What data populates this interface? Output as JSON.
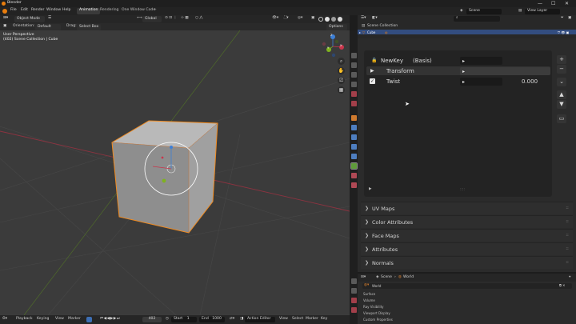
{
  "window": {
    "title": "Blender",
    "controls": [
      "—",
      "☐",
      "✕"
    ]
  },
  "menu": {
    "items": [
      "File",
      "Edit",
      "Render",
      "Window",
      "Help"
    ]
  },
  "workspace_tabs": [
    {
      "label": "Animation",
      "active": true
    },
    {
      "label": "Rendering",
      "active": false
    },
    {
      "label": "One Window Code",
      "active": false
    },
    {
      "label": "+",
      "active": false
    }
  ],
  "scene": {
    "label": "Scene",
    "view_layer": "View Layer"
  },
  "viewport_header": {
    "mode": "Object Mode",
    "transform": "Global"
  },
  "tool_settings": {
    "orientation_label": "Orientation:",
    "orientation_value": "Default",
    "drag_label": "Drag:",
    "drag_value": "Select Box",
    "options": "Options"
  },
  "viewport_info": {
    "line1": "User Perspective",
    "line2": "(402) Scene Collection | Cube"
  },
  "gizmo": {
    "x": "X",
    "y": "Y",
    "z": "Z"
  },
  "outliner": {
    "collection": "Scene Collection",
    "object": "Cube"
  },
  "shape_keys": [
    {
      "name": "NewKey",
      "suffix": "(Basis)",
      "value": "",
      "highlight": false
    },
    {
      "name": "Transform",
      "suffix": "",
      "value": "",
      "highlight": true
    },
    {
      "name": "Twist",
      "suffix": "",
      "value": "0.000",
      "highlight": false
    }
  ],
  "sections": [
    "UV Maps",
    "Color Attributes",
    "Face Maps",
    "Attributes",
    "Normals"
  ],
  "shader_header": {
    "scene": "Scene",
    "world": "World",
    "world_name": "World"
  },
  "shader_items": [
    "Surface",
    "Volume",
    "Ray Visibility",
    "Viewport Display",
    "Custom Properties"
  ],
  "timeline": {
    "menus": [
      "Playback",
      "Keying",
      "View",
      "Marker"
    ],
    "current_frame": "402",
    "start_label": "Start",
    "start": "1",
    "end_label": "End",
    "end": "1000",
    "editor": "Action Editor",
    "menus_right": [
      "View",
      "Select",
      "Marker",
      "Key"
    ]
  },
  "colors": {
    "accent": "#e87d0d",
    "selection": "#334d80",
    "x_axis": "#c9364c",
    "y_axis": "#7fb21f",
    "z_axis": "#3d7fd6"
  }
}
